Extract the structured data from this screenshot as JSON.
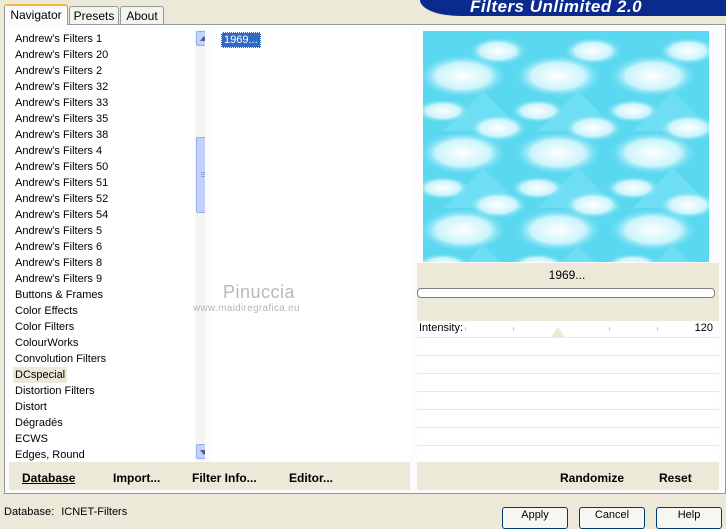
{
  "tabs": [
    {
      "label": "Navigator",
      "active": true
    },
    {
      "label": "Presets",
      "active": false
    },
    {
      "label": "About",
      "active": false
    }
  ],
  "banner": {
    "title": "Filters Unlimited 2.0"
  },
  "categories": {
    "selected": "DCspecial",
    "items": [
      "Andrew's Filters 1",
      "Andrew's Filters 20",
      "Andrew's Filters 2",
      "Andrew's Filters 32",
      "Andrew's Filters 33",
      "Andrew's Filters 35",
      "Andrew's Filters 38",
      "Andrew's Filters 4",
      "Andrew's Filters 50",
      "Andrew's Filters 51",
      "Andrew's Filters 52",
      "Andrew's Filters 54",
      "Andrew's Filters 5",
      "Andrew's Filters 6",
      "Andrew's Filters 8",
      "Andrew's Filters 9",
      "Buttons & Frames",
      "Color Effects",
      "Color Filters",
      "ColourWorks",
      "Convolution Filters",
      "DCspecial",
      "Distortion Filters",
      "Distort",
      "Dégradés",
      "ECWS",
      "Edges, Round"
    ]
  },
  "filters": {
    "items": [
      "1969..."
    ],
    "selected": "1969..."
  },
  "preview": {
    "filter_name": "1969..."
  },
  "controls": {
    "intensity_label": "Intensity:",
    "intensity_value": "120"
  },
  "buttons": {
    "database": "Database",
    "import": "Import...",
    "filter_info": "Filter Info...",
    "editor": "Editor...",
    "randomize": "Randomize",
    "reset": "Reset"
  },
  "status": {
    "database_label": "Database:",
    "database_value": "ICNET-Filters"
  },
  "dialog_buttons": {
    "apply": "Apply",
    "cancel": "Cancel",
    "help": "Help"
  },
  "watermark": {
    "name": "Pinuccia",
    "site": "www.maidiregrafica.eu"
  },
  "colors": {
    "banner": "#0a2b8c",
    "selection": "#316ac5",
    "preview_sky": "#5ad8f0"
  }
}
